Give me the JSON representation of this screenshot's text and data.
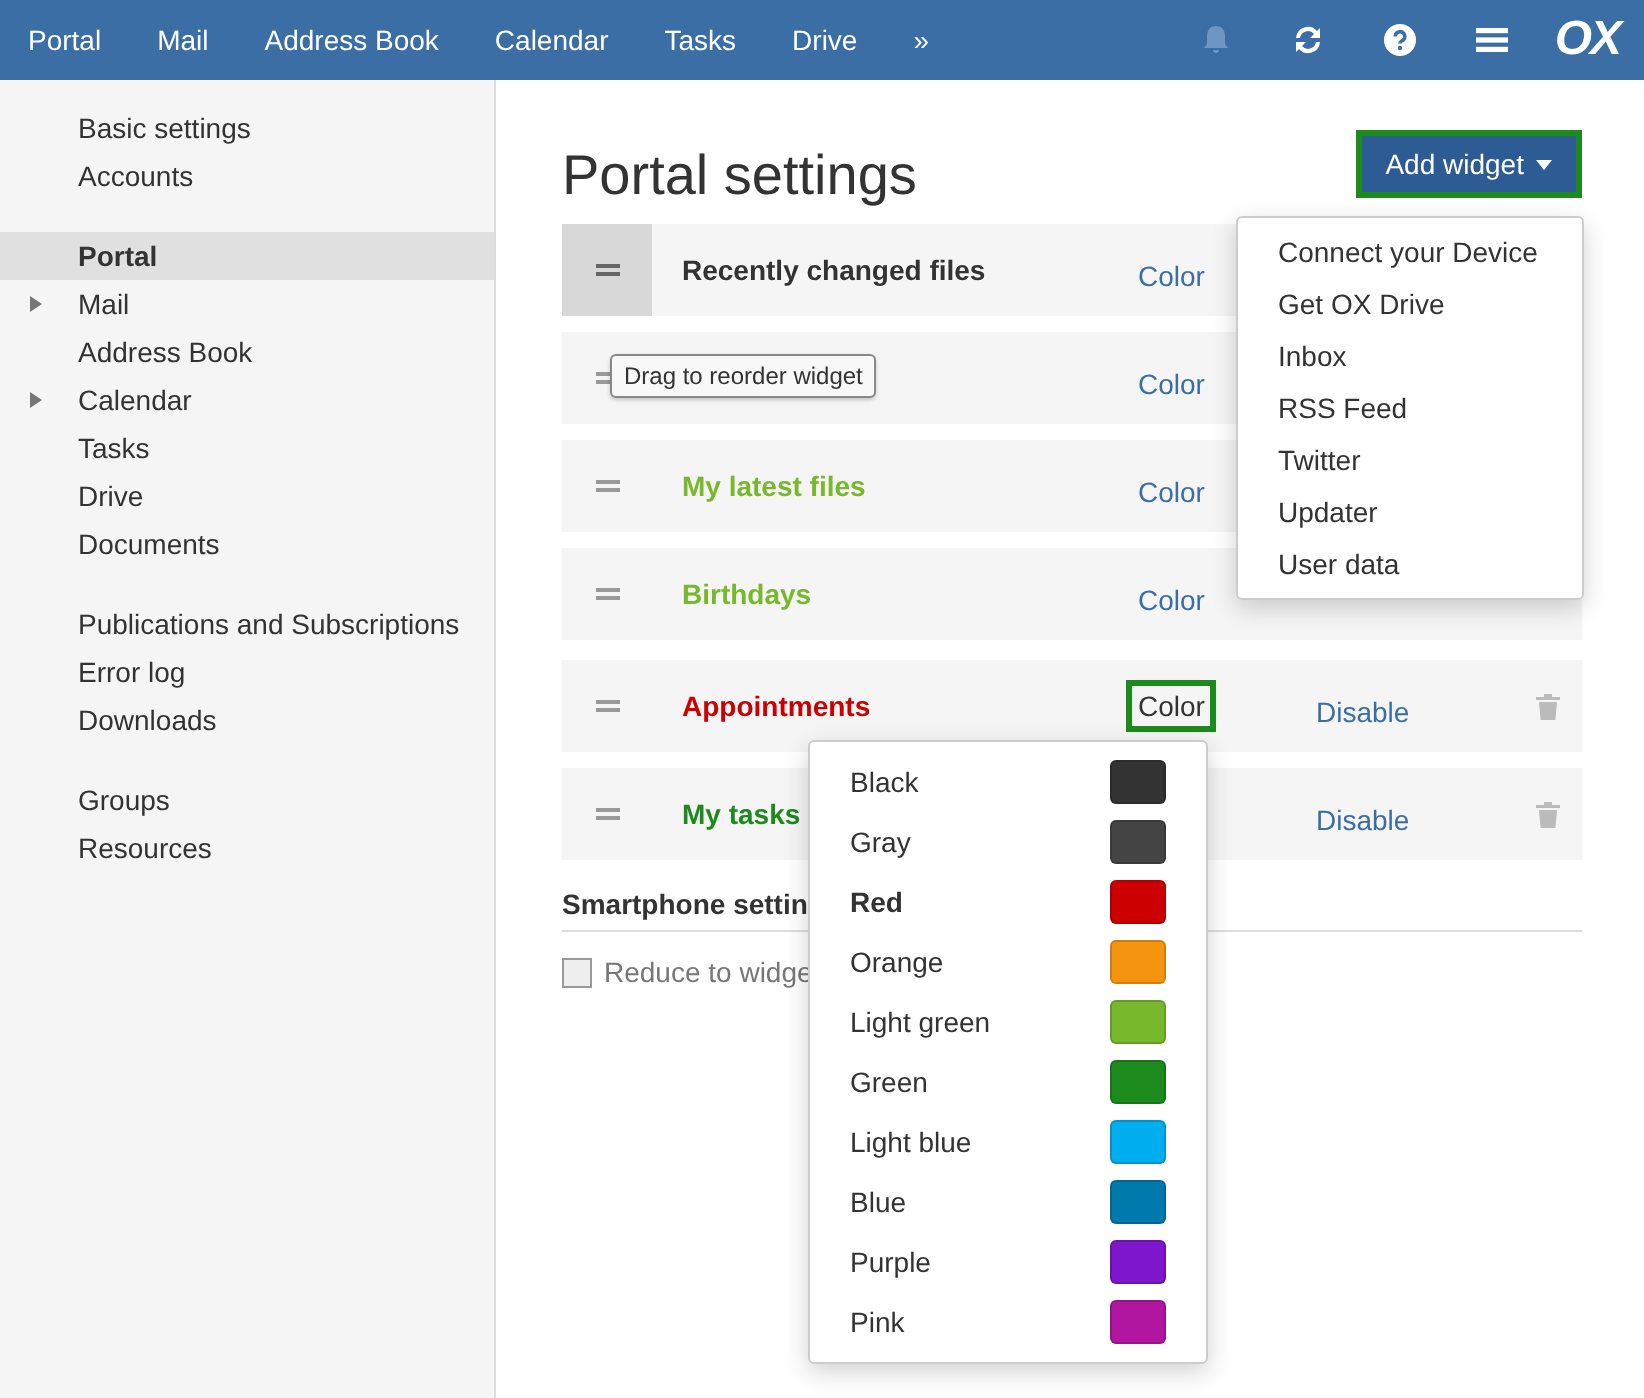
{
  "topbar": {
    "apps": [
      {
        "label": "Portal"
      },
      {
        "label": "Mail"
      },
      {
        "label": "Address Book"
      },
      {
        "label": "Calendar"
      },
      {
        "label": "Tasks"
      },
      {
        "label": "Drive"
      },
      {
        "label": "»"
      }
    ],
    "logo": "OX"
  },
  "sidebar": {
    "groups": [
      [
        {
          "label": "Basic settings",
          "selected": false,
          "expandable": false
        },
        {
          "label": "Accounts",
          "selected": false,
          "expandable": false
        }
      ],
      [
        {
          "label": "Portal",
          "selected": true,
          "expandable": false
        },
        {
          "label": "Mail",
          "selected": false,
          "expandable": true
        },
        {
          "label": "Address Book",
          "selected": false,
          "expandable": false
        },
        {
          "label": "Calendar",
          "selected": false,
          "expandable": true
        },
        {
          "label": "Tasks",
          "selected": false,
          "expandable": false
        },
        {
          "label": "Drive",
          "selected": false,
          "expandable": false
        },
        {
          "label": "Documents",
          "selected": false,
          "expandable": false
        }
      ],
      [
        {
          "label": "Publications and Subscriptions",
          "selected": false,
          "expandable": false
        },
        {
          "label": "Error log",
          "selected": false,
          "expandable": false
        },
        {
          "label": "Downloads",
          "selected": false,
          "expandable": false
        }
      ],
      [
        {
          "label": "Groups",
          "selected": false,
          "expandable": false
        },
        {
          "label": "Resources",
          "selected": false,
          "expandable": false
        }
      ]
    ]
  },
  "page": {
    "title": "Portal settings",
    "add_widget": {
      "label": "Add widget",
      "highlighted": true
    }
  },
  "widgets": [
    {
      "title": "Recently changed files",
      "color": "#333333",
      "handle_hover": true,
      "color_link": "Color"
    },
    {
      "handle_hover": false,
      "color_link": "Color",
      "tooltip": "Drag to reorder widget"
    },
    {
      "title": "My latest files",
      "color": "#77b82c",
      "handle_hover": false,
      "color_link": "Color"
    },
    {
      "title": "Birthdays",
      "color": "#77b82c",
      "handle_hover": false,
      "color_link": "Color"
    },
    {
      "title": "Appointments",
      "color": "#cc0000",
      "handle_hover": false,
      "color_link": "Color",
      "color_highlighted": true,
      "disable_link": "Disable",
      "removable": true
    },
    {
      "title": "My tasks",
      "color": "#1c8a1c",
      "handle_hover": false,
      "disable_link": "Disable",
      "removable": true
    }
  ],
  "smartphone": {
    "heading": "Smartphone settin",
    "option": {
      "label": "Reduce to widge",
      "checked": false
    }
  },
  "add_widget_menu": [
    {
      "label": "Connect your Device"
    },
    {
      "label": "Get OX Drive"
    },
    {
      "label": "Inbox"
    },
    {
      "label": "RSS Feed"
    },
    {
      "label": "Twitter"
    },
    {
      "label": "Updater"
    },
    {
      "label": "User data"
    }
  ],
  "color_menu": [
    {
      "label": "Black",
      "color": "#333333",
      "selected": false
    },
    {
      "label": "Gray",
      "color": "#444444",
      "selected": false
    },
    {
      "label": "Red",
      "color": "#cc0000",
      "selected": true
    },
    {
      "label": "Orange",
      "color": "#f5940f",
      "selected": false
    },
    {
      "label": "Light green",
      "color": "#77b82c",
      "selected": false
    },
    {
      "label": "Green",
      "color": "#1c8a1c",
      "selected": false
    },
    {
      "label": "Light blue",
      "color": "#00adef",
      "selected": false
    },
    {
      "label": "Blue",
      "color": "#0079ad",
      "selected": false
    },
    {
      "label": "Purple",
      "color": "#7d16cc",
      "selected": false
    },
    {
      "label": "Pink",
      "color": "#b0169f",
      "selected": false
    }
  ]
}
